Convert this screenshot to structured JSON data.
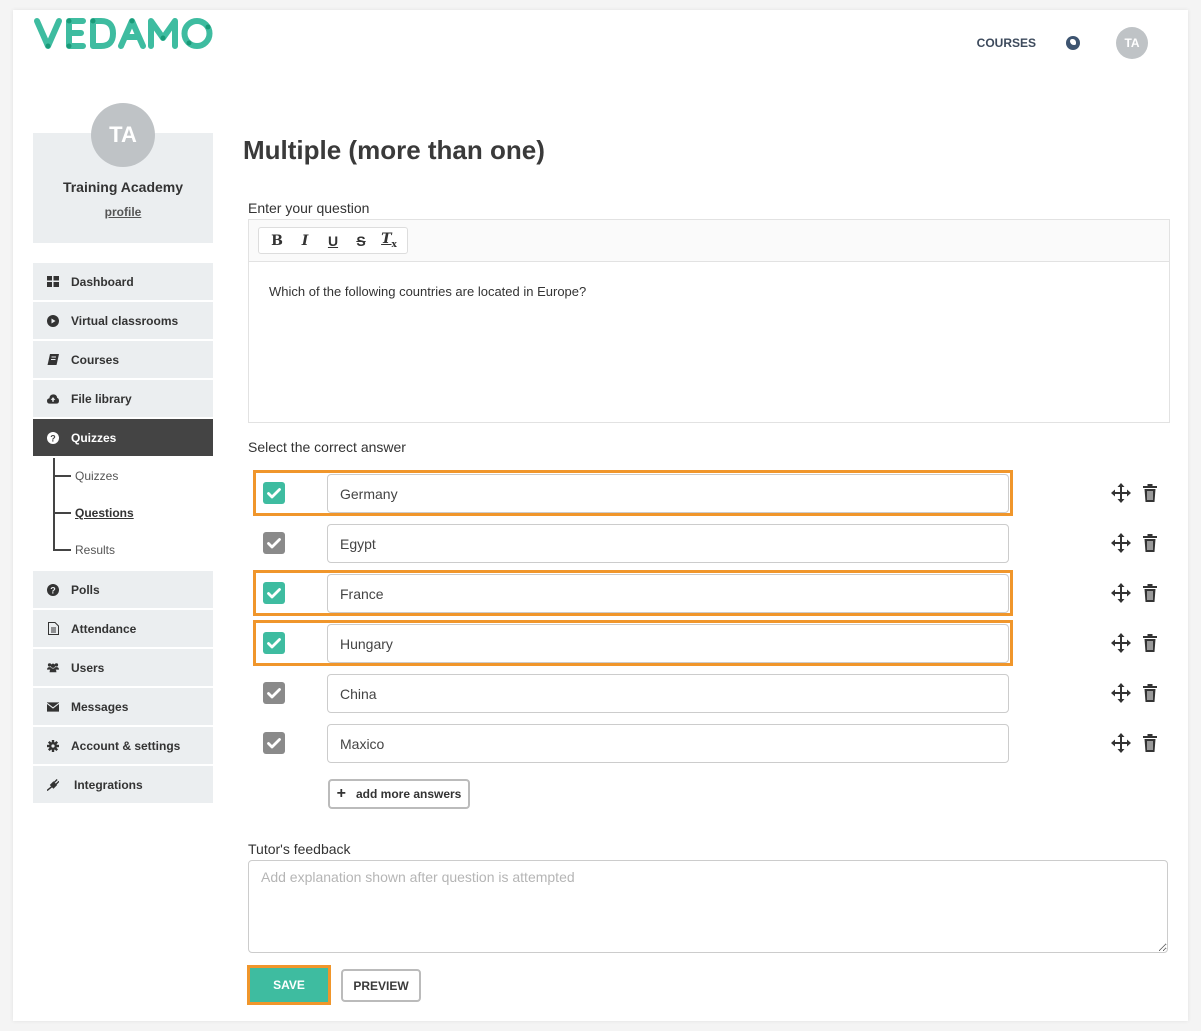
{
  "brand": {
    "logo_text": "VEDAMO",
    "color": "#3ebca0"
  },
  "topnav": {
    "courses_label": "COURSES",
    "language_icon": "globe-icon",
    "avatar_initials": "TA"
  },
  "profile": {
    "initials": "TA",
    "name": "Training Academy",
    "link_label": "profile"
  },
  "sidebar": {
    "items": [
      {
        "label": "Dashboard",
        "icon": "dashboard-icon"
      },
      {
        "label": "Virtual classrooms",
        "icon": "play-circle-icon"
      },
      {
        "label": "Courses",
        "icon": "book-icon"
      },
      {
        "label": "File library",
        "icon": "cloud-upload-icon"
      },
      {
        "label": "Quizzes",
        "icon": "question-circle-icon",
        "active": true
      },
      {
        "label": "Polls",
        "icon": "question-circle-icon"
      },
      {
        "label": "Attendance",
        "icon": "document-icon"
      },
      {
        "label": "Users",
        "icon": "users-icon"
      },
      {
        "label": "Messages",
        "icon": "envelope-icon"
      },
      {
        "label": "Account & settings",
        "icon": "gear-icon"
      },
      {
        "label": "Integrations",
        "icon": "plug-icon"
      }
    ],
    "subitems": [
      {
        "label": "Quizzes"
      },
      {
        "label": "Questions",
        "active": true
      },
      {
        "label": "Results"
      }
    ]
  },
  "main": {
    "title": "Multiple (more than one)",
    "question_label": "Enter your question",
    "toolbar": {
      "bold": "B",
      "italic": "I",
      "underline": "U",
      "strike": "S",
      "clear": "T",
      "clear_sub": "x"
    },
    "question_text": "Which of the following countries are located in Europe?",
    "answers_label": "Select the correct answer",
    "answers": [
      {
        "text": "Germany",
        "correct": true,
        "highlighted": true
      },
      {
        "text": "Egypt",
        "correct": false,
        "highlighted": false
      },
      {
        "text": "France",
        "correct": true,
        "highlighted": true
      },
      {
        "text": "Hungary",
        "correct": true,
        "highlighted": true
      },
      {
        "text": "China",
        "correct": false,
        "highlighted": false
      },
      {
        "text": "Maxico",
        "correct": false,
        "highlighted": false
      }
    ],
    "add_answers_label": "add more answers",
    "feedback_label": "Tutor's feedback",
    "feedback_placeholder": "Add explanation shown after question is attempted",
    "feedback_value": "",
    "save_label": "SAVE",
    "preview_label": "PREVIEW"
  },
  "colors": {
    "accent": "#3ebca0",
    "highlight": "#f0962b",
    "unchecked": "#8a8a8a",
    "active_nav": "#444444"
  }
}
